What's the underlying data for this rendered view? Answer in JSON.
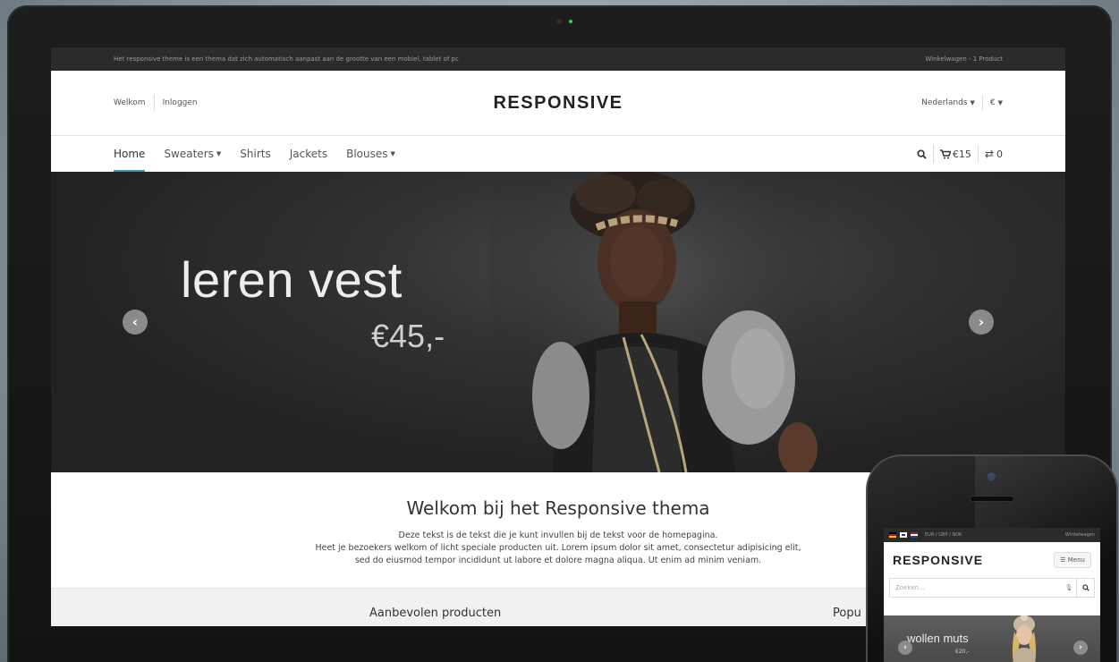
{
  "site": {
    "infobar": {
      "message": "Het responsive theme is een thema dat zich automatisch aanpast aan de grootte van een mobiel, tablet of pc",
      "cart_summary": "Winkelwagen - 1 Product"
    },
    "header": {
      "welcome": "Welkom",
      "login": "Inloggen",
      "logo": "RESPONSIVE",
      "language": "Nederlands",
      "currency": "€"
    },
    "nav": {
      "items": [
        {
          "label": "Home",
          "dropdown": false
        },
        {
          "label": "Sweaters",
          "dropdown": true
        },
        {
          "label": "Shirts",
          "dropdown": false
        },
        {
          "label": "Jackets",
          "dropdown": false
        },
        {
          "label": "Blouses",
          "dropdown": true
        }
      ],
      "cart_total": "€15",
      "compare_count": "0"
    },
    "hero": {
      "title": "leren vest",
      "price": "€45,-"
    },
    "welcome": {
      "heading": "Welkom bij het Responsive thema",
      "line1": "Deze tekst is de tekst die je kunt invullen bij de tekst voor de homepagina.",
      "line2": "Heet je bezoekers welkom of licht speciale producten uit. Lorem ipsum dolor sit amet, consectetur adipisicing elit,",
      "line3": "sed do eiusmod tempor incididunt ut labore et dolore magna aliqua. Ut enim ad minim veniam."
    },
    "sections": {
      "featured": "Aanbevolen producten",
      "popular": "Popu"
    }
  },
  "mobile": {
    "currencies": "EUR / GBP / NOK",
    "cart": "Winkelwagen",
    "logo": "RESPONSIVE",
    "menu": "Menu",
    "search_placeholder": "Zoeken...",
    "hero_title": "wollen muts",
    "hero_price": "€20,-"
  },
  "colors": {
    "accent": "#2e9eb6",
    "infobar_bg": "#2b2b2b",
    "hero_bg": "#262626"
  },
  "icons": [
    "search-icon",
    "cart-icon",
    "compare-icon",
    "chevron-left-icon",
    "chevron-right-icon",
    "microphone-icon",
    "menu-icon"
  ]
}
